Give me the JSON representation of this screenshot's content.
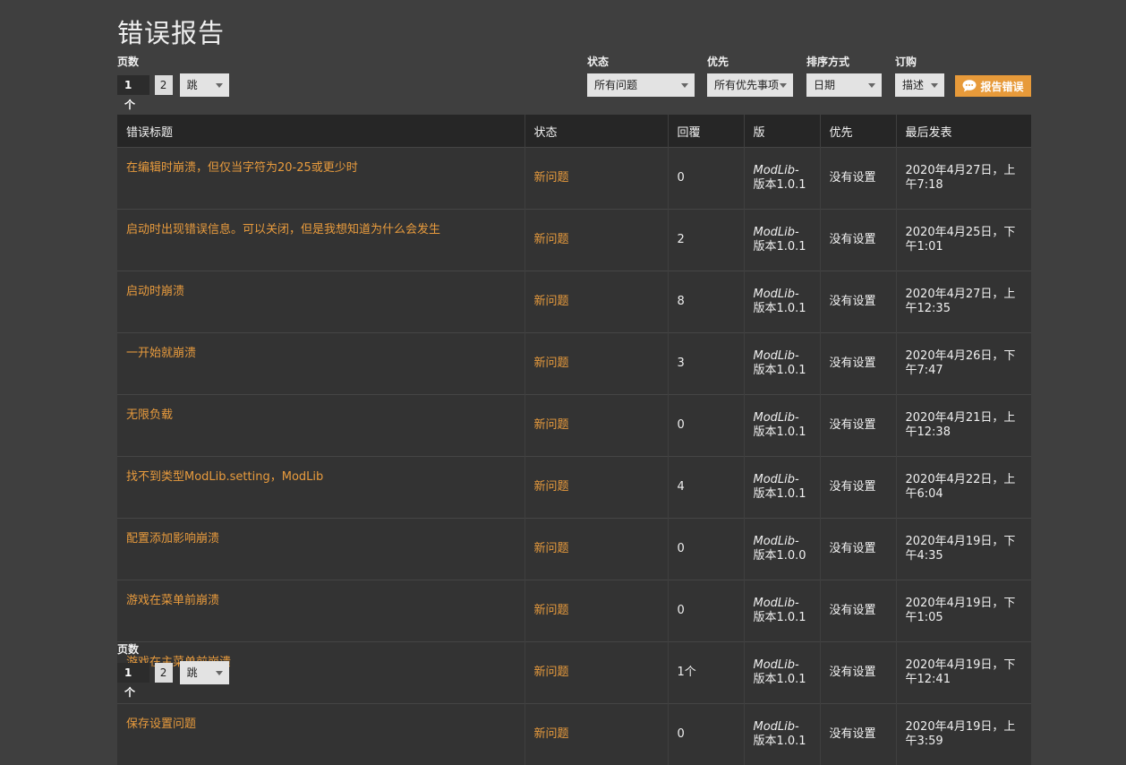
{
  "page": {
    "title": "错误报告"
  },
  "pager": {
    "label": "页数",
    "current": "1个",
    "next": "2",
    "jump": "跳"
  },
  "filters": {
    "status": {
      "label": "状态",
      "value": "所有问题"
    },
    "priority": {
      "label": "优先",
      "value": "所有优先事项"
    },
    "sort": {
      "label": "排序方式",
      "value": "日期"
    },
    "order": {
      "label": "订购",
      "value": "描述"
    },
    "report_button": "报告错误"
  },
  "table": {
    "headers": {
      "title": "错误标题",
      "status": "状态",
      "replies": "回覆",
      "version": "版",
      "priority": "优先",
      "last_post": "最后发表"
    },
    "rows": [
      {
        "title": "在编辑时崩溃，但仅当字符为20-25或更少时",
        "status": "新问题",
        "replies": "0",
        "version_name": "ModLib-",
        "version": "版本1.0.1",
        "priority": "没有设置",
        "last_post": "2020年4月27日，上午7:18"
      },
      {
        "title": "启动时出现错误信息。可以关闭，但是我想知道为什么会发生",
        "status": "新问题",
        "replies": "2",
        "version_name": "ModLib-",
        "version": "版本1.0.1",
        "priority": "没有设置",
        "last_post": "2020年4月25日，下午1:01"
      },
      {
        "title": "启动时崩溃",
        "status": "新问题",
        "replies": "8",
        "version_name": "ModLib-",
        "version": "版本1.0.1",
        "priority": "没有设置",
        "last_post": "2020年4月27日，上午12:35"
      },
      {
        "title": "一开始就崩溃",
        "status": "新问题",
        "replies": "3",
        "version_name": "ModLib-",
        "version": "版本1.0.1",
        "priority": "没有设置",
        "last_post": "2020年4月26日，下午7:47"
      },
      {
        "title": "无限负载",
        "status": "新问题",
        "replies": "0",
        "version_name": "ModLib-",
        "version": "版本1.0.1",
        "priority": "没有设置",
        "last_post": "2020年4月21日，上午12:38"
      },
      {
        "title": "找不到类型ModLib.setting，ModLib",
        "status": "新问题",
        "replies": "4",
        "version_name": "ModLib-",
        "version": "版本1.0.1",
        "priority": "没有设置",
        "last_post": "2020年4月22日，上午6:04"
      },
      {
        "title": "配置添加影响崩溃",
        "status": "新问题",
        "replies": "0",
        "version_name": "ModLib-",
        "version": "版本1.0.0",
        "priority": "没有设置",
        "last_post": "2020年4月19日，下午4:35"
      },
      {
        "title": "游戏在菜单前崩溃",
        "status": "新问题",
        "replies": "0",
        "version_name": "ModLib-",
        "version": "版本1.0.1",
        "priority": "没有设置",
        "last_post": "2020年4月19日，下午1:05"
      },
      {
        "title": "游戏在主菜单前崩溃",
        "status": "新问题",
        "replies": "1个",
        "version_name": "ModLib-",
        "version": "版本1.0.1",
        "priority": "没有设置",
        "last_post": "2020年4月19日，下午12:41"
      },
      {
        "title": "保存设置问题",
        "status": "新问题",
        "replies": "0",
        "version_name": "ModLib-",
        "version": "版本1.0.1",
        "priority": "没有设置",
        "last_post": "2020年4月19日，上午3:59"
      }
    ]
  },
  "colors": {
    "background": "#3f3f3f",
    "accent": "#e89b3d",
    "header_bg": "#262626",
    "row_bg": "#333333"
  },
  "icons": {
    "report_button_icon": "speech-bubble-icon",
    "select_caret": "chevron-down-icon"
  }
}
